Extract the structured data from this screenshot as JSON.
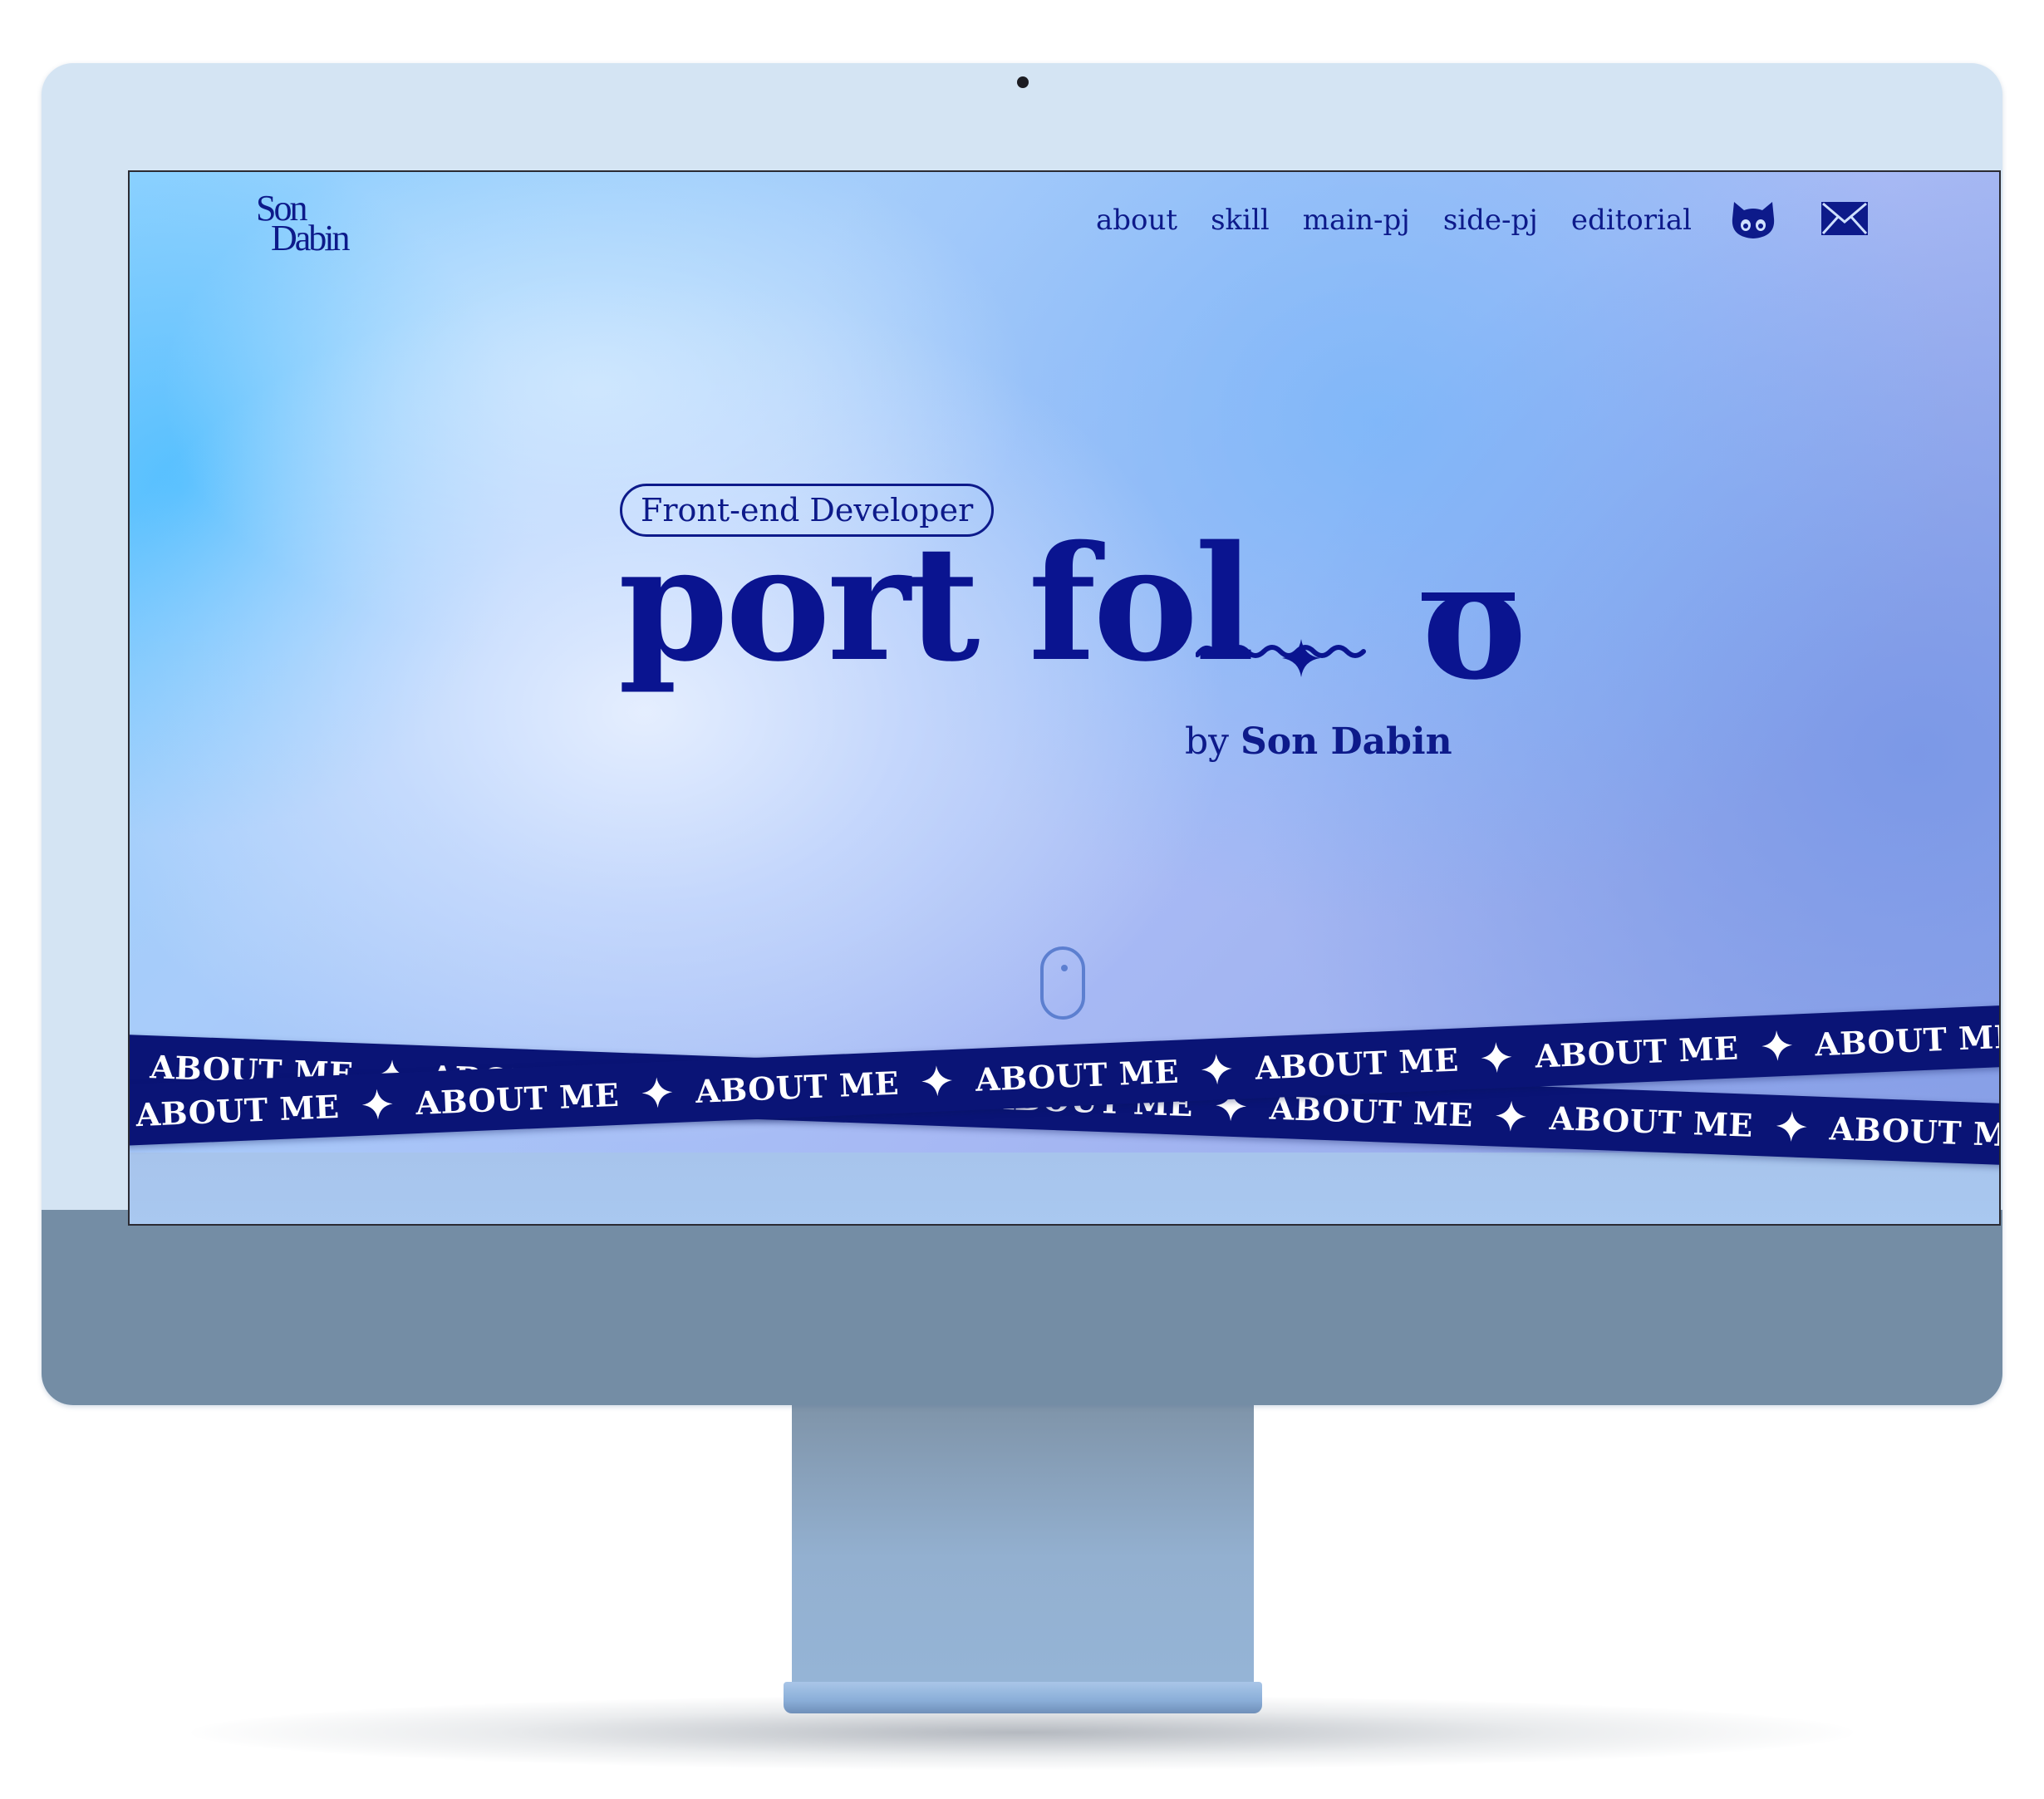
{
  "colors": {
    "accent": "#0d1a8a",
    "band": "#0a1476",
    "monitor_frame": "#d4e4f3",
    "monitor_chin": "#748da5"
  },
  "site": {
    "logo": {
      "line1": "Son",
      "line2": "Dabin"
    },
    "nav": [
      {
        "label": "about"
      },
      {
        "label": "skill"
      },
      {
        "label": "main-pj"
      },
      {
        "label": "side-pj"
      },
      {
        "label": "editorial"
      }
    ],
    "icons": [
      "github-icon",
      "mail-icon"
    ]
  },
  "hero": {
    "tag": "Front-end Developer",
    "title_main": "port fol",
    "title_end": "o",
    "by_prefix": "by",
    "by_name": "Son Dabin",
    "scroll_hint_icon": "mouse-icon"
  },
  "marquee": {
    "text": "ABOUT ME",
    "separator_icon": "sparkle-icon"
  }
}
